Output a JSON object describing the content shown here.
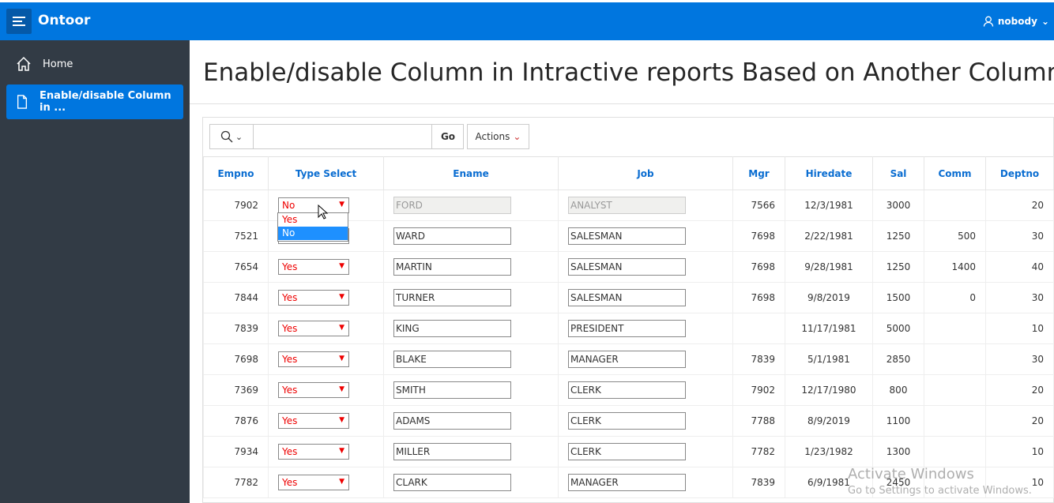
{
  "app": {
    "name": "Ontoor",
    "user": "nobody"
  },
  "sidebar": {
    "items": [
      {
        "label": "Home",
        "icon": "home-icon"
      },
      {
        "label": "Enable/disable Column in ...",
        "icon": "page-icon",
        "active": true
      }
    ]
  },
  "page": {
    "title": "Enable/disable Column in Intractive reports Based on Another Column"
  },
  "toolbar": {
    "search_value": "",
    "go_label": "Go",
    "actions_label": "Actions"
  },
  "table": {
    "columns": [
      "Empno",
      "Type Select",
      "Ename",
      "Job",
      "Mgr",
      "Hiredate",
      "Sal",
      "Comm",
      "Deptno"
    ],
    "rows": [
      [
        "7902",
        "No",
        "FORD",
        "ANALYST",
        "7566",
        "12/3/1981",
        "3000",
        "",
        "20"
      ],
      [
        "7521",
        "Yes",
        "WARD",
        "SALESMAN",
        "7698",
        "2/22/1981",
        "1250",
        "500",
        "30"
      ],
      [
        "7654",
        "Yes",
        "MARTIN",
        "SALESMAN",
        "7698",
        "9/28/1981",
        "1250",
        "1400",
        "40"
      ],
      [
        "7844",
        "Yes",
        "TURNER",
        "SALESMAN",
        "7698",
        "9/8/2019",
        "1500",
        "0",
        "30"
      ],
      [
        "7839",
        "Yes",
        "KING",
        "PRESIDENT",
        "",
        "11/17/1981",
        "5000",
        "",
        "10"
      ],
      [
        "7698",
        "Yes",
        "BLAKE",
        "MANAGER",
        "7839",
        "5/1/1981",
        "2850",
        "",
        "30"
      ],
      [
        "7369",
        "Yes",
        "SMITH",
        "CLERK",
        "7902",
        "12/17/1980",
        "800",
        "",
        "20"
      ],
      [
        "7876",
        "Yes",
        "ADAMS",
        "CLERK",
        "7788",
        "8/9/2019",
        "1100",
        "",
        "20"
      ],
      [
        "7934",
        "Yes",
        "MILLER",
        "CLERK",
        "7782",
        "1/23/1982",
        "1300",
        "",
        "10"
      ],
      [
        "7782",
        "Yes",
        "CLARK",
        "MANAGER",
        "7839",
        "6/9/1981",
        "2450",
        "",
        "10"
      ]
    ]
  },
  "dropdown": {
    "options": [
      "Yes",
      "No"
    ],
    "highlighted": "No"
  },
  "watermark": {
    "line1": "Activate Windows",
    "line2": "Go to Settings to activate Windows."
  }
}
